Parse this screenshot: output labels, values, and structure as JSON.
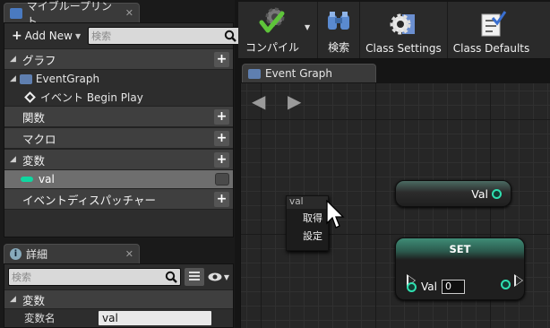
{
  "my_blueprint": {
    "tab_title": "マイブループリント",
    "add_new_label": "Add New",
    "search_placeholder": "検索",
    "sections": {
      "graph": "グラフ",
      "event_graph": "EventGraph",
      "begin_play": "イベント Begin Play",
      "functions": "関数",
      "macros": "マクロ",
      "variables": "変数",
      "event_dispatchers": "イベントディスパッチャー"
    },
    "variable_item": "val"
  },
  "details": {
    "tab_title": "詳細",
    "search_placeholder": "検索",
    "section_title": "変数",
    "variable_name_label": "変数名",
    "variable_name_value": "val"
  },
  "toolbar": {
    "compile_label": "コンパイル",
    "find_label": "検索",
    "class_settings_label": "Class Settings",
    "class_defaults_label": "Class Defaults"
  },
  "graph": {
    "tab_title": "Event Graph",
    "get_node_label": "Val",
    "set_node_title": "SET",
    "set_pin_label": "Val",
    "set_pin_value": "0",
    "context_menu": {
      "header": "val",
      "get": "取得",
      "set": "設定"
    }
  },
  "colors": {
    "accent_variable": "#0fd6a0",
    "background": "#151515"
  }
}
